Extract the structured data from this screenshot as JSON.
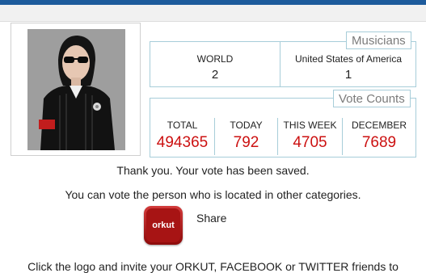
{
  "musicians_panel": {
    "title": "Musicians",
    "world_label": "WORLD",
    "world_value": "2",
    "country_label": "United States of America",
    "country_value": "1"
  },
  "vote_panel": {
    "title": "Vote Counts",
    "total_label": "TOTAL",
    "total_value": "494365",
    "today_label": "TODAY",
    "today_value": "792",
    "week_label": "THIS WEEK",
    "week_value": "4705",
    "month_label": "DECEMBER",
    "month_value": "7689"
  },
  "messages": {
    "saved": "Thank you. Your vote has been saved.",
    "other": "You can vote the person who is located in other categories.",
    "share": "Share",
    "orkut_logo": "orkut",
    "footer": "Click the logo and invite your ORKUT, FACEBOOK or TWITTER friends to"
  },
  "colors": {
    "topbar": "#1d5b9c",
    "panel_border": "#a7cdd9",
    "count_red": "#cc1111"
  }
}
